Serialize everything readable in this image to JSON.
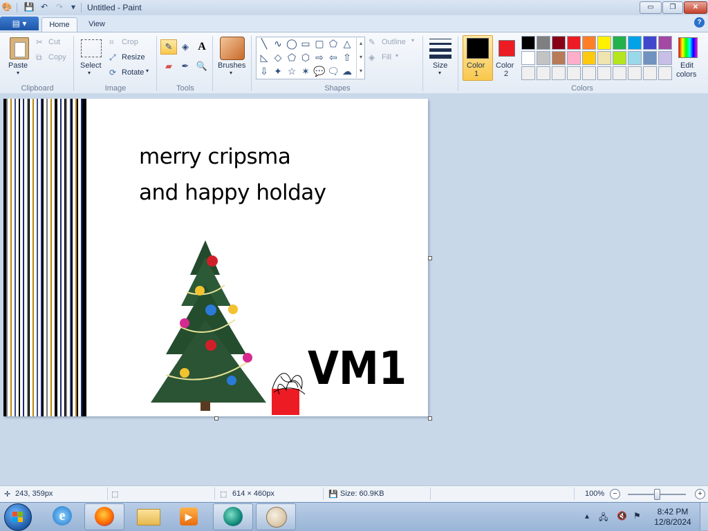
{
  "window": {
    "title": "Untitled - Paint",
    "qat_icons": [
      "paint-app-icon",
      "save-icon",
      "undo-icon",
      "redo-icon",
      "customize-qat-icon"
    ],
    "controls": {
      "minimize": "▭",
      "maximize": "❐",
      "close": "✕"
    }
  },
  "ribbon": {
    "app_menu_label": "▤ ▾",
    "tabs": [
      "Home",
      "View"
    ],
    "help_label": "?",
    "clipboard": {
      "paste": "Paste",
      "cut": "Cut",
      "copy": "Copy",
      "group": "Clipboard"
    },
    "image": {
      "select": "Select",
      "crop": "Crop",
      "resize": "Resize",
      "rotate": "Rotate",
      "group": "Image"
    },
    "tools": {
      "group": "Tools",
      "items": [
        "pencil-icon",
        "fill-icon",
        "text-icon",
        "eraser-icon",
        "color-picker-icon",
        "magnifier-icon"
      ]
    },
    "brushes": {
      "label": "Brushes"
    },
    "shapes": {
      "group": "Shapes",
      "outline": "Outline",
      "fill": "Fill",
      "glyphs": [
        "╲",
        "∿",
        "◯",
        "▭",
        "▢",
        "⬠",
        "△",
        "◺",
        "◇",
        "⬠",
        "⬡",
        "⇨",
        "⇦",
        "⇧",
        "⇩",
        "✦",
        "☆",
        "✶",
        "💬",
        "🗨",
        "☁"
      ]
    },
    "size": {
      "label": "Size"
    },
    "colors": {
      "color1": "Color",
      "color1_num": "1",
      "color2": "Color",
      "color2_num": "2",
      "edit": "Edit",
      "edit2": "colors",
      "group": "Colors",
      "color1_value": "#000000",
      "color2_value": "#ed1c24",
      "palette_row1": [
        "#000000",
        "#7f7f7f",
        "#880015",
        "#ed1c24",
        "#ff7f27",
        "#fff200",
        "#22b14c",
        "#00a2e8",
        "#3f48cc",
        "#a349a4"
      ],
      "palette_row2": [
        "#ffffff",
        "#c3c3c3",
        "#b97a57",
        "#ffaec9",
        "#ffc90e",
        "#efe4b0",
        "#b5e61d",
        "#99d9ea",
        "#7092be",
        "#c8bfe7"
      ],
      "palette_row3": [
        "#f0f0f0",
        "#f0f0f0",
        "#f0f0f0",
        "#f0f0f0",
        "#f0f0f0",
        "#f0f0f0",
        "#f0f0f0",
        "#f0f0f0",
        "#f0f0f0",
        "#f0f0f0"
      ]
    }
  },
  "canvas": {
    "line1": "merry cripsma",
    "line2": "and happy holday",
    "signature": "VM1",
    "stripe_colors": [
      "#000000",
      "#1b2a6b",
      "#b8860b",
      "#7a7a7a",
      "#ffffff",
      "#3a4a8a"
    ]
  },
  "status": {
    "cursor_pos": "243, 359px",
    "canvas_size": "614 × 460px",
    "file_size": "Size: 60.9KB",
    "zoom": "100%",
    "zoom_out": "−",
    "zoom_in": "+",
    "zoom_fraction": 0.5
  },
  "taskbar": {
    "apps": [
      "internet-explorer-icon",
      "firefox-icon",
      "file-explorer-icon",
      "media-player-icon",
      "app-icon",
      "paint-icon"
    ],
    "time": "8:42 PM",
    "date": "12/8/2024",
    "tray_icons": [
      "show-hidden-icons-icon",
      "network-icon",
      "volume-muted-icon",
      "flag-icon"
    ]
  }
}
